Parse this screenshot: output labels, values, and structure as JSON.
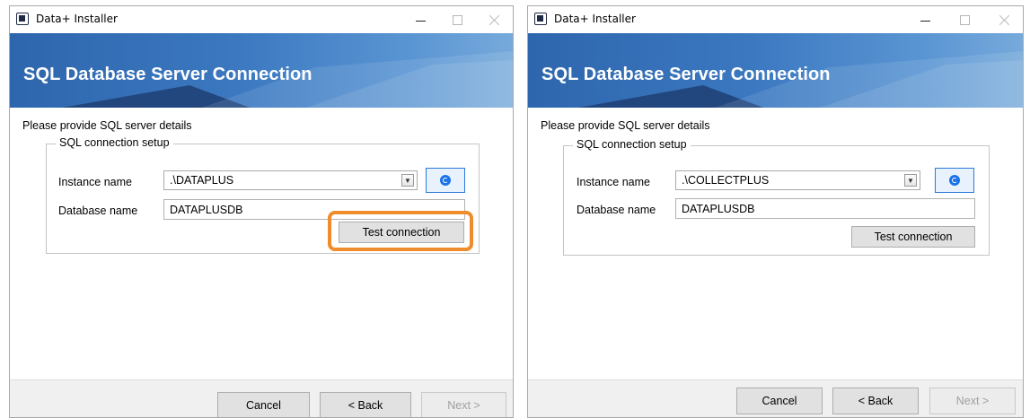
{
  "windows": [
    {
      "title": "Data+ Installer",
      "header": "SQL Database Server Connection",
      "prompt": "Please provide SQL server details",
      "group_label": "SQL connection setup",
      "instance_label": "Instance name",
      "instance_value": ".\\DATAPLUS",
      "database_label": "Database name",
      "database_value": "DATAPLUSDB",
      "test_button": "Test connection",
      "cancel_button": "Cancel",
      "back_button": "< Back",
      "next_button": "Next >"
    },
    {
      "title": "Data+ Installer",
      "header": "SQL Database Server Connection",
      "prompt": "Please provide SQL server details",
      "group_label": "SQL connection setup",
      "instance_label": "Instance name",
      "instance_value": ".\\COLLECTPLUS",
      "database_label": "Database name",
      "database_value": "DATAPLUSDB",
      "test_button": "Test connection",
      "cancel_button": "Cancel",
      "back_button": "< Back",
      "next_button": "Next >"
    }
  ],
  "icons": {
    "app": "app-window-icon",
    "refresh": "refresh-icon",
    "dropdown": "chevron-down-icon"
  },
  "colors": {
    "banner": "#3b78c0",
    "highlight": "#ef8c2b",
    "refresh_accent": "#1a73e8"
  }
}
